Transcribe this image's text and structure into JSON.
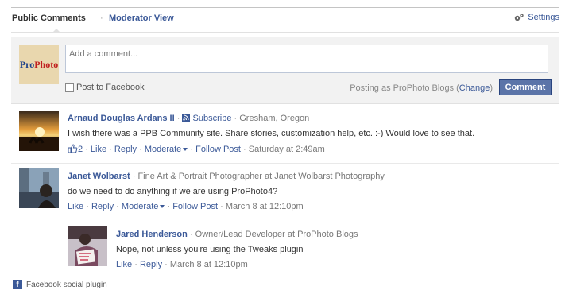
{
  "tabs": {
    "public": "Public Comments",
    "sep": "·",
    "moderator": "Moderator View",
    "settings": "Settings"
  },
  "composer": {
    "placeholder": "Add a comment...",
    "post_to_facebook": "Post to Facebook",
    "posting_as": "Posting as ProPhoto Blogs (",
    "change": "Change",
    "posting_close": ")",
    "button": "Comment",
    "avatar_text_a": "Pro",
    "avatar_text_b": "Photo"
  },
  "comments": [
    {
      "name": "Arnaud Douglas Ardans II",
      "sep1": "·",
      "subscribe": "Subscribe",
      "sep2": "·",
      "location": "Gresham, Oregon",
      "text": "I wish there was a PPB Community site. Share stories, customization help, etc. :-) Would love to see that.",
      "likes": "2",
      "like": "Like",
      "reply": "Reply",
      "moderate": "Moderate",
      "follow": "Follow Post",
      "time": "Saturday at 2:49am",
      "dot": "·"
    },
    {
      "name": "Janet Wolbarst",
      "title": "· Fine Art & Portrait Photographer at Janet Wolbarst Photography",
      "text": "do we need to do anything if we are using ProPhoto4?",
      "like": "Like",
      "reply": "Reply",
      "moderate": "Moderate",
      "follow": "Follow Post",
      "time": "March 8 at 12:10pm",
      "dot": "·"
    },
    {
      "name": "Jared Henderson",
      "title": "· Owner/Lead Developer at ProPhoto Blogs",
      "text": "Nope, not unless you're using the Tweaks plugin",
      "like": "Like",
      "reply": "Reply",
      "time": "March 8 at 12:10pm",
      "dot": "·"
    }
  ],
  "footer": {
    "label": "Facebook social plugin",
    "icon": "f"
  },
  "colors": {
    "link": "#3b5998",
    "button": "#5b74a8",
    "composer_bg": "#f2f2f2"
  }
}
